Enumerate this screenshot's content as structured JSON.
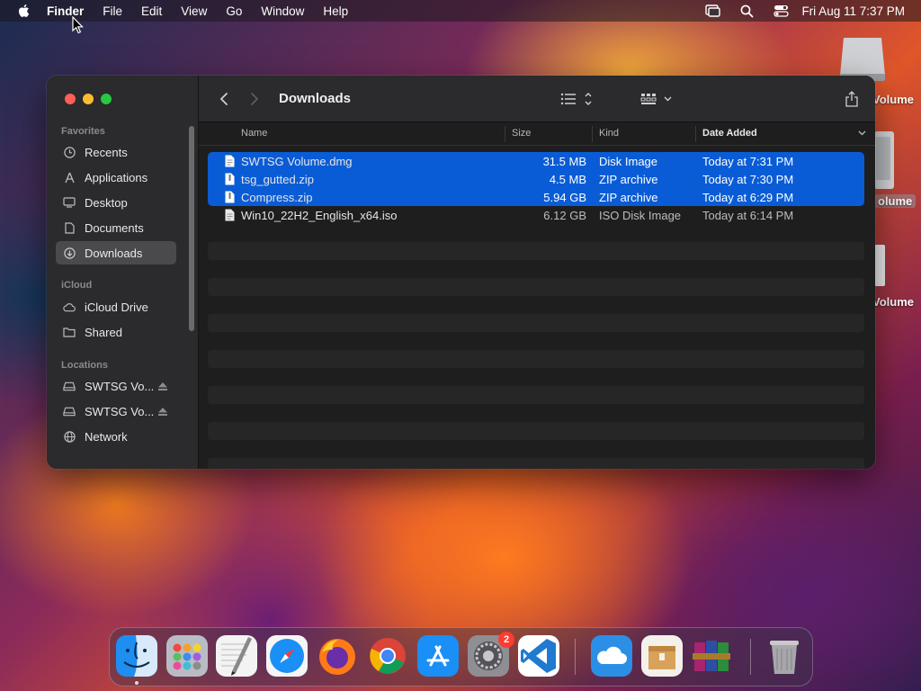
{
  "menubar": {
    "app": "Finder",
    "items": [
      "File",
      "Edit",
      "View",
      "Go",
      "Window",
      "Help"
    ],
    "clock": "Fri Aug 11  7:37 PM"
  },
  "desktop": {
    "labels": [
      "Volume",
      "olume",
      "Volume"
    ]
  },
  "window": {
    "title": "Downloads",
    "sidebar": {
      "favorites_header": "Favorites",
      "favorites": [
        {
          "label": "Recents",
          "icon": "clock-icon"
        },
        {
          "label": "Applications",
          "icon": "applications-icon"
        },
        {
          "label": "Desktop",
          "icon": "desktop-icon"
        },
        {
          "label": "Documents",
          "icon": "document-icon"
        },
        {
          "label": "Downloads",
          "icon": "download-icon",
          "active": true
        }
      ],
      "icloud_header": "iCloud",
      "icloud": [
        {
          "label": "iCloud Drive",
          "icon": "cloud-icon"
        },
        {
          "label": "Shared",
          "icon": "shared-folder-icon"
        }
      ],
      "locations_header": "Locations",
      "locations": [
        {
          "label": "SWTSG Vo...",
          "icon": "drive-icon"
        },
        {
          "label": "SWTSG Vo...",
          "icon": "drive-icon"
        },
        {
          "label": "Network",
          "icon": "globe-icon"
        }
      ]
    },
    "columns": {
      "name": "Name",
      "size": "Size",
      "kind": "Kind",
      "date": "Date Added"
    },
    "files": [
      {
        "name": "SWTSG Volume.dmg",
        "size": "31.5 MB",
        "kind": "Disk Image",
        "date": "Today at 7:31 PM",
        "selected": true
      },
      {
        "name": "tsg_gutted.zip",
        "size": "4.5 MB",
        "kind": "ZIP archive",
        "date": "Today at 7:30 PM",
        "selected": true
      },
      {
        "name": "Compress.zip",
        "size": "5.94 GB",
        "kind": "ZIP archive",
        "date": "Today at 6:29 PM",
        "selected": true
      },
      {
        "name": "Win10_22H2_English_x64.iso",
        "size": "6.12 GB",
        "kind": "ISO Disk Image",
        "date": "Today at 6:14 PM",
        "selected": false
      }
    ]
  },
  "dock": {
    "apps": [
      "Finder",
      "Launchpad",
      "TextEdit",
      "Safari",
      "Firefox",
      "Chrome",
      "App Store",
      "System Settings",
      "VS Code",
      "Weather",
      "Archive Utility",
      "WinRAR",
      "Trash"
    ],
    "settings_badge": "2"
  },
  "colors": {
    "selection": "#0a5cd6",
    "sidebar": "#2b2a2c",
    "content": "#1e1e1e"
  }
}
